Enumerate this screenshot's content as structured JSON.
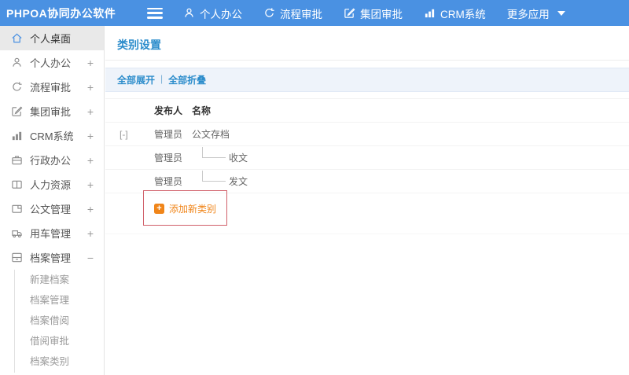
{
  "header": {
    "logo": "PHPOA协同办公软件",
    "nav": [
      {
        "label": "个人办公",
        "icon": "user-icon"
      },
      {
        "label": "流程审批",
        "icon": "process-icon"
      },
      {
        "label": "集团审批",
        "icon": "edit-icon"
      },
      {
        "label": "CRM系统",
        "icon": "chart-icon"
      },
      {
        "label": "更多应用",
        "icon": "caret-down-icon"
      }
    ]
  },
  "sidebar": {
    "items": [
      {
        "label": "个人桌面",
        "icon": "home-icon",
        "active": true,
        "expander": ""
      },
      {
        "label": "个人办公",
        "icon": "user-icon",
        "expander": "+"
      },
      {
        "label": "流程审批",
        "icon": "process-icon",
        "expander": "+"
      },
      {
        "label": "集团审批",
        "icon": "edit-icon",
        "expander": "+"
      },
      {
        "label": "CRM系统",
        "icon": "chart-icon",
        "expander": "+"
      },
      {
        "label": "行政办公",
        "icon": "briefcase-icon",
        "expander": "+"
      },
      {
        "label": "人力资源",
        "icon": "hr-icon",
        "expander": "+"
      },
      {
        "label": "公文管理",
        "icon": "document-icon",
        "expander": "+"
      },
      {
        "label": "用车管理",
        "icon": "vehicle-icon",
        "expander": "+"
      },
      {
        "label": "档案管理",
        "icon": "archive-icon",
        "expander": "−",
        "expanded": true
      }
    ],
    "submenu": [
      "新建档案",
      "档案管理",
      "档案借阅",
      "借阅审批",
      "档案类别"
    ]
  },
  "main": {
    "title": "类别设置",
    "toolbar": {
      "expand_all": "全部展开",
      "divider": "|",
      "collapse_all": "全部折叠"
    },
    "table": {
      "columns": {
        "publisher": "发布人",
        "name": "名称"
      },
      "rows": [
        {
          "toggle": "[-]",
          "publisher": "管理员",
          "name": "公文存档",
          "is_child": false
        },
        {
          "toggle": "",
          "publisher": "管理员",
          "name": "收文",
          "is_child": true
        },
        {
          "toggle": "",
          "publisher": "管理员",
          "name": "发文",
          "is_child": true
        }
      ],
      "add_button": "添加新类别"
    }
  },
  "colors": {
    "header_bg": "#4a91e2",
    "accent_blue": "#2b8ccb",
    "add_orange": "#f08519",
    "highlight_border": "#d0606a",
    "active_item_bg": "#e9e9e9"
  }
}
